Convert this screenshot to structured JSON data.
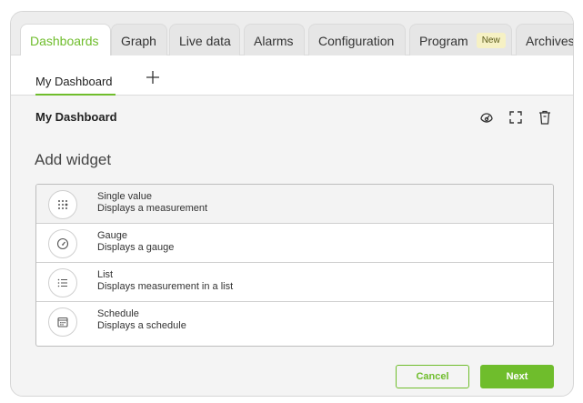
{
  "tabs": [
    {
      "label": "Dashboards"
    },
    {
      "label": "Graph"
    },
    {
      "label": "Live data"
    },
    {
      "label": "Alarms"
    },
    {
      "label": "Configuration"
    },
    {
      "label": "Program",
      "badge": "New"
    },
    {
      "label": "Archives"
    }
  ],
  "subtabs": {
    "active": "My Dashboard",
    "add_icon": "plus-icon"
  },
  "dashboard": {
    "title": "My Dashboard",
    "actions": [
      "gauge-icon",
      "fullscreen-icon",
      "trash-icon"
    ]
  },
  "add_widget": {
    "heading": "Add widget",
    "items": [
      {
        "title": "Single value",
        "description": "Displays a measurement",
        "icon": "dot-grid-icon",
        "selected": true
      },
      {
        "title": "Gauge",
        "description": "Displays a gauge",
        "icon": "gauge-icon",
        "selected": false
      },
      {
        "title": "List",
        "description": "Displays measurement in a list",
        "icon": "list-icon",
        "selected": false
      },
      {
        "title": "Schedule",
        "description": "Displays a schedule",
        "icon": "calendar-icon",
        "selected": false
      }
    ]
  },
  "buttons": {
    "cancel": "Cancel",
    "next": "Next"
  },
  "colors": {
    "accent": "#6fbd2c",
    "badge_bg": "#f6f1c4"
  }
}
